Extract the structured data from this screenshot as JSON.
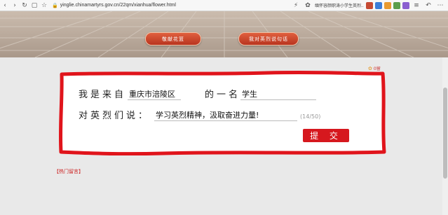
{
  "browser": {
    "url": "yinglie.chinamartyrs.gov.cn/22qm/xianhua/flower.html",
    "news_snippet": "缅怀容颜职涛小学生英烈..."
  },
  "banner": {
    "left_button": "敬献花篮",
    "right_button": "我对英烈说句话"
  },
  "badge": {
    "label": "0留"
  },
  "form": {
    "line1_prefix": "我是来自",
    "location": "重庆市涪陵区",
    "line1_middle": "的一名",
    "identity": "学生",
    "line2_prefix": "对英烈们说：",
    "message": "学习英烈精神，汲取奋进力量!",
    "counter": "(14/50)",
    "submit_label": "提 交"
  },
  "hot_messages_link": "【热门留言】",
  "colors": {
    "accent_red": "#d6181e",
    "frame_red": "#e0141b"
  }
}
